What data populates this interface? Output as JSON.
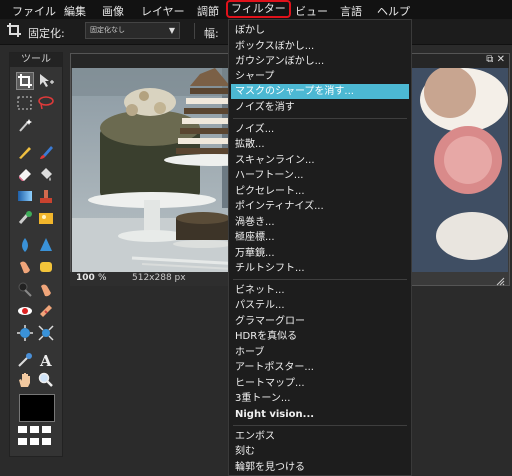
{
  "menubar": {
    "items": [
      "ファイル",
      "編集",
      "画像",
      "レイヤー",
      "調節",
      "フィルター",
      "ビュー",
      "言語",
      "ヘルプ"
    ],
    "active_item": "フィルター",
    "active_border_color": "#e0121b"
  },
  "options_bar": {
    "tool_icon": "crop-icon",
    "fixed_label": "固定化:",
    "fixed_value": "固定化なし",
    "width_label": "幅:"
  },
  "tool_panel": {
    "title": "ツール"
  },
  "image_window": {
    "zoom": "100",
    "zoom_unit": "%",
    "dimensions": "512x288 px"
  },
  "filter_menu": {
    "highlight_color": "#4cb8d3",
    "items": [
      "ぼかし",
      "ボックスぼかし...",
      "ガウシアンぼかし...",
      "シャープ",
      "マスクのシャープを消す...",
      "ノイズを消す",
      "ノイズ...",
      "拡散...",
      "スキャンライン...",
      "ハーフトーン...",
      "ピクセレート...",
      "ポインティナイズ...",
      "渦巻き...",
      "極座標...",
      "万華鏡...",
      "チルトシフト...",
      "ビネット...",
      "パステル...",
      "グラマーグロー",
      "HDRを真似る",
      "ホーブ",
      "アートポスター...",
      "ヒートマップ...",
      "3重トーン...",
      "Night vision...",
      "エンボス",
      "刻む",
      "輪郭を見つける"
    ]
  }
}
